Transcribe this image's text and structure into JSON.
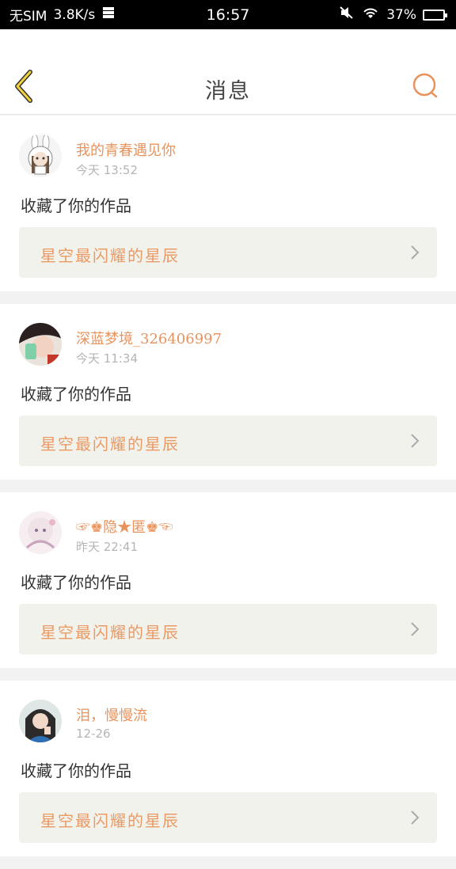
{
  "status_bar": {
    "carrier": "无SIM",
    "speed": "3.8K/s",
    "time": "16:57",
    "battery": "37%"
  },
  "header": {
    "title": "消息"
  },
  "colors": {
    "accent": "#e8935c",
    "background": "#f2f2f2",
    "card": "#ffffff",
    "work_bg": "#f2f2ec"
  },
  "messages": [
    {
      "user": "我的青春遇见你",
      "time": "今天 13:52",
      "action": "收藏了你的作品",
      "work": "星空最闪耀的星辰"
    },
    {
      "user": "深蓝梦境_326406997",
      "time": "今天 11:34",
      "action": "收藏了你的作品",
      "work": "星空最闪耀的星辰"
    },
    {
      "user": "☞♚隐★匿♚☜",
      "time": "昨天 22:41",
      "action": "收藏了你的作品",
      "work": "星空最闪耀的星辰"
    },
    {
      "user": "泪，慢慢流",
      "time": "12-26",
      "action": "收藏了你的作品",
      "work": "星空最闪耀的星辰"
    }
  ]
}
